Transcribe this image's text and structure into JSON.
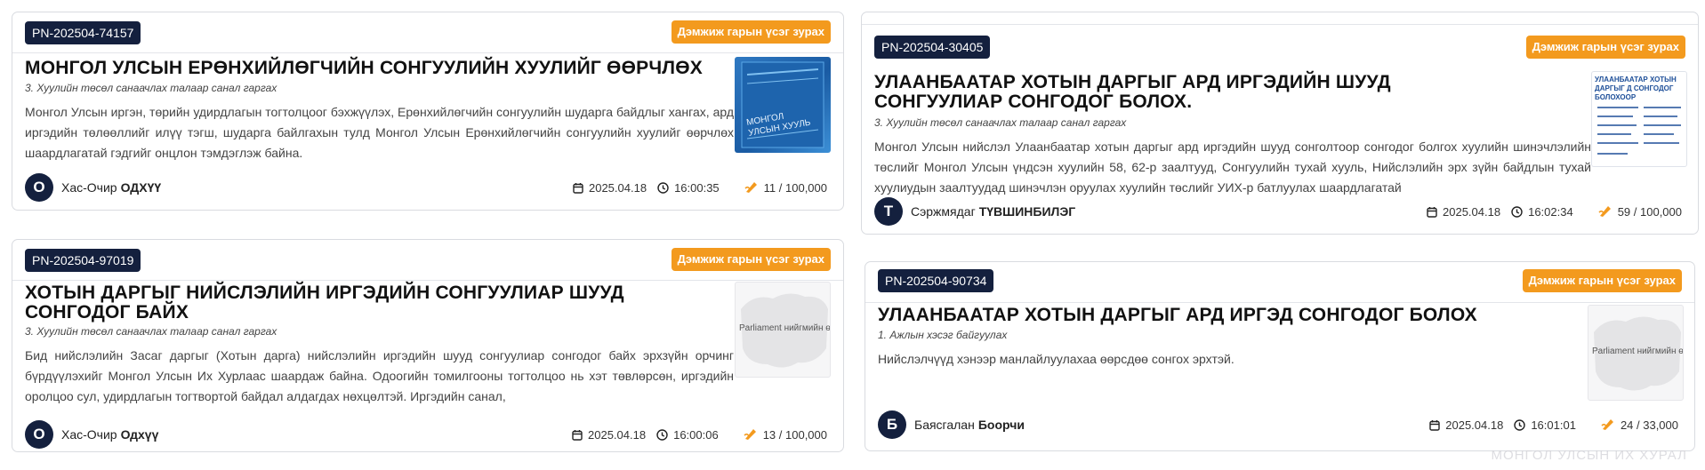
{
  "action_label": "Дэмжиж гарын үсэг зурах",
  "cards": [
    {
      "pn": "PN-202504-74157",
      "title": "МОНГОЛ УЛСЫН ЕРӨНХИЙЛӨГЧИЙН СОНГУУЛИЙН ХУУЛИЙГ ӨӨРЧЛӨХ",
      "category": "3. Хуулийн төсөл санаачлах талаар санал гаргах",
      "description": "Монгол Улсын иргэн, төрийн удирдлагын тогтолцоог бэхжүүлэх, Ерөнхийлөгчийн сонгуулийн шударга байдлыг хангах, ард иргэдийн төлөөллийг илүү тэгш, шударга байлгахын тулд Монгол Улсын Ерөнхийлөгчийн сонгуулийн хуулийг өөрчлөх шаардлагатай гэдгийг онцлон тэмдэглэж байна.",
      "thumb_text": "МОНГОЛ УЛСЫН ХУУЛЬ",
      "author_initial": "О",
      "author_first": "Хас-Очир",
      "author_last": "ОДХҮҮ",
      "date": "2025.04.18",
      "time": "16:00:35",
      "signatures": "11 / 100,000"
    },
    {
      "pn": "PN-202504-97019",
      "title": "ХОТЫН ДАРГЫГ НИЙСЛЭЛИЙН ИРГЭДИЙН СОНГУУЛИАР ШУУД СОНГОДОГ БАЙХ",
      "category": "3. Хуулийн төсөл санаачлах талаар санал гаргах",
      "description": "Бид нийслэлийн Засаг даргыг (Хотын дарга) нийслэлийн иргэдийн шууд сонгуулиар сонгодог байх эрхзүйн орчинг бүрдүүлэхийг Монгол Улсын Их Хурлаас шаардаж байна. Одоогийн томилгооны тогтолцоо нь хэт төвлөрсөн, иргэдийн оролцоо сул, удирдлагын тогтвортой байдал алдагдах нөхцөлтэй. Иргэдийн санал,",
      "thumb_text": "Parliament нийгмийн өгөө",
      "author_initial": "О",
      "author_first": "Хас-Очир",
      "author_last": "Одхүү",
      "date": "2025.04.18",
      "time": "16:00:06",
      "signatures": "13 / 100,000"
    },
    {
      "pn": "PN-202504-30405",
      "title": "УЛААНБААТАР ХОТЫН ДАРГЫГ АРД ИРГЭДИЙН ШУУД СОНГУУЛИАР СОНГОДОГ БОЛОХ.",
      "category": "3. Хуулийн төсөл санаачлах талаар санал гаргах",
      "description": "Монгол Улсын нийслэл Улаанбаатар хотын даргыг ард иргэдийн шууд сонголтоор сонгодог болгох хуулийн шинэчлэлийн төслийг Монгол Улсын үндсэн хуулийн 58, 62-р заалтууд, Сонгуулийн тухай хууль, Нийслэлийн эрх зүйн байдлын тухай хуулиудын заалтуудад шинэчлэн оруулах хуулийн төслийг УИХ-р батлуулах шаардлагатай",
      "thumb_text": "УЛААНБААТАР ХОТЫН ДАРГЫГ Д СОНГОДОГ БОЛОХООР",
      "author_initial": "Т",
      "author_first": "Сэржмядаг",
      "author_last": "ТҮВШИНБИЛЭГ",
      "date": "2025.04.18",
      "time": "16:02:34",
      "signatures": "59 / 100,000"
    },
    {
      "pn": "PN-202504-90734",
      "title": "УЛААНБААТАР ХОТЫН ДАРГЫГ АРД ИРГЭД СОНГОДОГ БОЛОХ",
      "category": "1. Ажлын хэсэг байгуулах",
      "description": "Нийслэлчүүд хэнээр манлайлуулахаа өөрсдөө сонгох эрхтэй.",
      "thumb_text": "Parliament нийгмийн өгөө",
      "author_initial": "Б",
      "author_first": "Баясгалан",
      "author_last": "Боорчи",
      "date": "2025.04.18",
      "time": "16:01:01",
      "signatures": "24 / 33,000"
    }
  ],
  "watermark": "МОНГОЛ УЛСЫН ИХ ХУРАЛ"
}
